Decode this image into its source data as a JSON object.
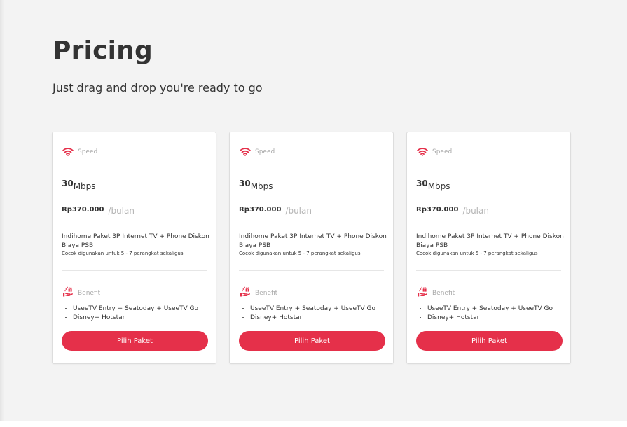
{
  "page": {
    "title": "Pricing",
    "subtitle": "Just drag and drop you're ready to go"
  },
  "colors": {
    "accent": "#e5304a",
    "background": "#f3f3f3",
    "card": "#ffffff"
  },
  "plans": [
    {
      "speed_label": "Speed",
      "speed_icon": "wifi-icon",
      "speed_value": "30",
      "speed_unit": "Mbps",
      "price": "Rp370.000",
      "period": "/bulan",
      "package_name": "Indihome Paket 3P Internet TV + Phone Diskon Biaya PSB",
      "package_note": "Cocok digunakan untuk 5 - 7 perangkat sekaligus",
      "benefit_label": "Benefit",
      "benefit_icon": "gift-hand-icon",
      "benefits": [
        "UseeTV Entry + Seatoday + UseeTV Go",
        "Disney+ Hotstar"
      ],
      "cta_label": "Pilih Paket"
    },
    {
      "speed_label": "Speed",
      "speed_icon": "wifi-icon",
      "speed_value": "30",
      "speed_unit": "Mbps",
      "price": "Rp370.000",
      "period": "/bulan",
      "package_name": "Indihome Paket 3P Internet TV + Phone Diskon Biaya PSB",
      "package_note": "Cocok digunakan untuk 5 - 7 perangkat sekaligus",
      "benefit_label": "Benefit",
      "benefit_icon": "gift-hand-icon",
      "benefits": [
        "UseeTV Entry + Seatoday + UseeTV Go",
        "Disney+ Hotstar"
      ],
      "cta_label": "Pilih Paket"
    },
    {
      "speed_label": "Speed",
      "speed_icon": "wifi-icon",
      "speed_value": "30",
      "speed_unit": "Mbps",
      "price": "Rp370.000",
      "period": "/bulan",
      "package_name": "Indihome Paket 3P Internet TV + Phone Diskon Biaya PSB",
      "package_note": "Cocok digunakan untuk 5 - 7 perangkat sekaligus",
      "benefit_label": "Benefit",
      "benefit_icon": "gift-hand-icon",
      "benefits": [
        "UseeTV Entry + Seatoday + UseeTV Go",
        "Disney+ Hotstar"
      ],
      "cta_label": "Pilih Paket"
    }
  ]
}
